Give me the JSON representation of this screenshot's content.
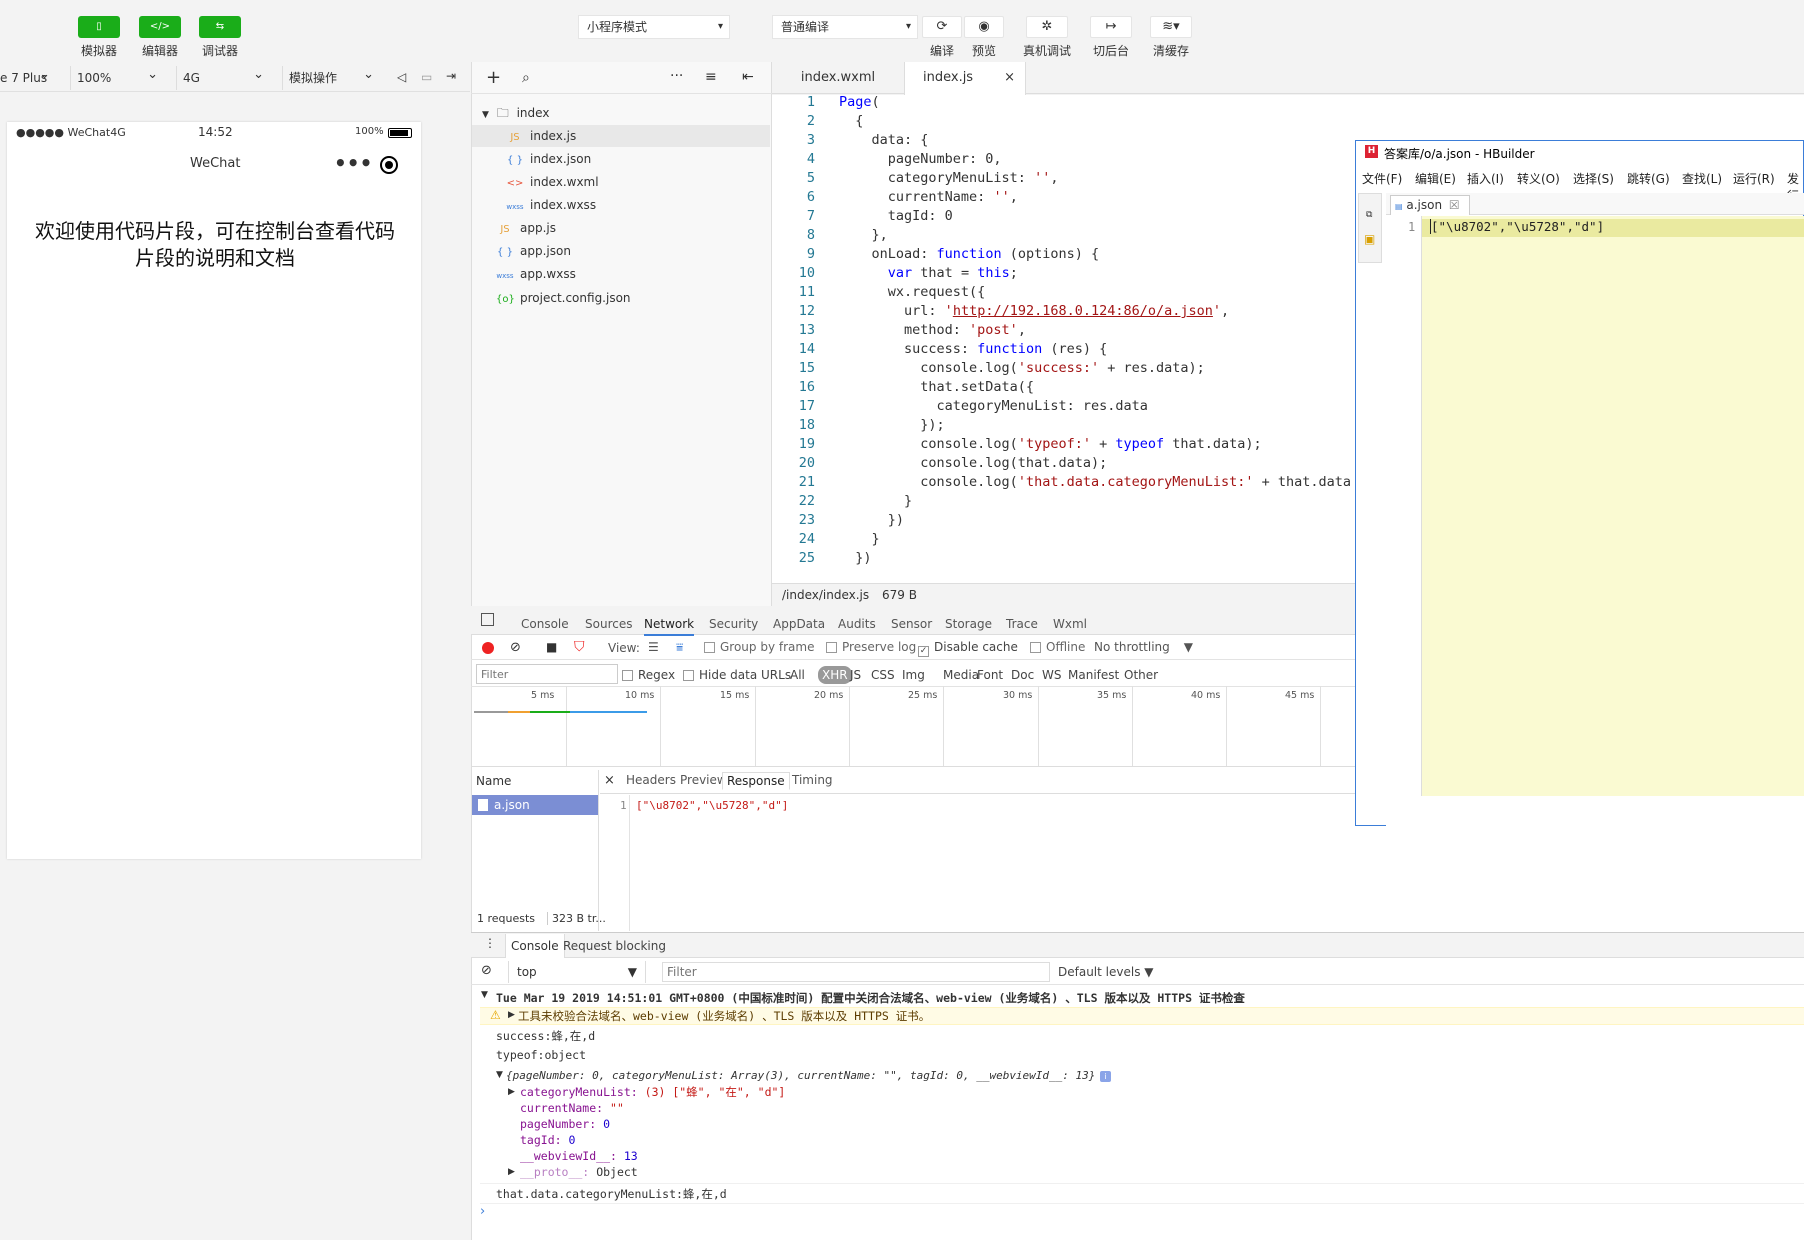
{
  "toolbar": {
    "simulator": "模拟器",
    "editor": "编辑器",
    "debugger": "调试器",
    "mode_select": "小程序模式",
    "compile_select": "普通编译",
    "compile": "编译",
    "preview": "预览",
    "real_debug": "真机调试",
    "backend": "切后台",
    "clear_cache": "清缓存"
  },
  "sim_bar": {
    "device": "e 7 Plus",
    "zoom": "100%",
    "network": "4G",
    "operation": "模拟操作"
  },
  "phone": {
    "carrier": "●●●●● WeChat4G",
    "time": "14:52",
    "battery": "100%",
    "nav_title": "WeChat",
    "welcome": "欢迎使用代码片段，可在控制台查看代码片段的说明和文档"
  },
  "tree": {
    "folder": "index",
    "items": [
      {
        "icon": "JS",
        "name": "index.js"
      },
      {
        "icon": "{ }",
        "name": "index.json"
      },
      {
        "icon": "<>",
        "name": "index.wxml"
      },
      {
        "icon": "wxss",
        "name": "index.wxss"
      },
      {
        "icon": "JS",
        "name": "app.js"
      },
      {
        "icon": "{ }",
        "name": "app.json"
      },
      {
        "icon": "wxss",
        "name": "app.wxss"
      },
      {
        "icon": "{o}",
        "name": "project.config.json"
      }
    ]
  },
  "editor": {
    "tabs": [
      "index.wxml",
      "index.js"
    ],
    "status_path": "/index/index.js",
    "status_size": "679 B",
    "line_numbers": [
      "1",
      "2",
      "3",
      "4",
      "5",
      "6",
      "7",
      "8",
      "9",
      "10",
      "11",
      "12",
      "13",
      "14",
      "15",
      "16",
      "17",
      "18",
      "19",
      "20",
      "21",
      "22",
      "23",
      "24",
      "25"
    ]
  },
  "devtools": {
    "tabs": [
      "Console",
      "Sources",
      "Network",
      "Security",
      "AppData",
      "Audits",
      "Sensor",
      "Storage",
      "Trace",
      "Wxml"
    ],
    "view_label": "View:",
    "group_by_frame": "Group by frame",
    "preserve_log": "Preserve log",
    "disable_cache": "Disable cache",
    "offline": "Offline",
    "throttling": "No throttling",
    "filter_placeholder": "Filter",
    "regex": "Regex",
    "hide_data_urls": "Hide data URLs",
    "type_filters": [
      "All",
      "XHR",
      "JS",
      "CSS",
      "Img",
      "Media",
      "Font",
      "Doc",
      "WS",
      "Manifest",
      "Other"
    ],
    "ruler": [
      "5 ms",
      "10 ms",
      "15 ms",
      "20 ms",
      "25 ms",
      "30 ms",
      "35 ms",
      "40 ms",
      "45 ms"
    ],
    "name_header": "Name",
    "request_name": "a.json",
    "detail_tabs": [
      "Headers",
      "Preview",
      "Response",
      "Timing"
    ],
    "response_line_no": "1",
    "response_body": "[\"\\u8702\",\"\\u5728\",\"d\"]",
    "summary_requests": "1 requests",
    "summary_size": "323 B tr..."
  },
  "console": {
    "tabs": [
      "Console",
      "Request blocking"
    ],
    "context": "top",
    "filter_placeholder": "Filter",
    "levels": "Default levels",
    "group_header": "Tue Mar 19 2019 14:51:01 GMT+0800 (中国标准时间) 配置中关闭合法域名、web-view (业务域名) 、TLS 版本以及 HTTPS 证书检查",
    "warning": "工具未校验合法域名、web-view (业务域名) 、TLS 版本以及 HTTPS 证书。",
    "log_success": "success:蜂,在,d",
    "log_typeof": "typeof:object",
    "obj_summary": "{pageNumber: 0, categoryMenuList: Array(3), currentName: \"\", tagId: 0, __webviewId__: 13}",
    "prop_category_key": "categoryMenuList:",
    "prop_category_val": "(3) [\"蜂\", \"在\", \"d\"]",
    "prop_current_key": "currentName:",
    "prop_current_val": "\"\"",
    "prop_page_key": "pageNumber:",
    "prop_page_val": "0",
    "prop_tag_key": "tagId:",
    "prop_tag_val": "0",
    "prop_webview_key": "__webviewId__:",
    "prop_webview_val": "13",
    "prop_proto_key": "__proto__:",
    "prop_proto_val": "Object",
    "log_category": "that.data.categoryMenuList:蜂,在,d"
  },
  "hbuilder": {
    "title": "答案库/o/a.json  -  HBuilder",
    "menu": [
      "文件(F)",
      "编辑(E)",
      "插入(I)",
      "转义(O)",
      "选择(S)",
      "跳转(G)",
      "查找(L)",
      "运行(R)",
      "发行"
    ],
    "tab": "a.json",
    "line_no": "1",
    "content": "[\"\\u8702\",\"\\u5728\",\"d\"]"
  },
  "colors": {
    "brand_green": "#1aad19",
    "hbuilder_bg": "#fafad2",
    "selected_request": "#7b8ed4"
  }
}
